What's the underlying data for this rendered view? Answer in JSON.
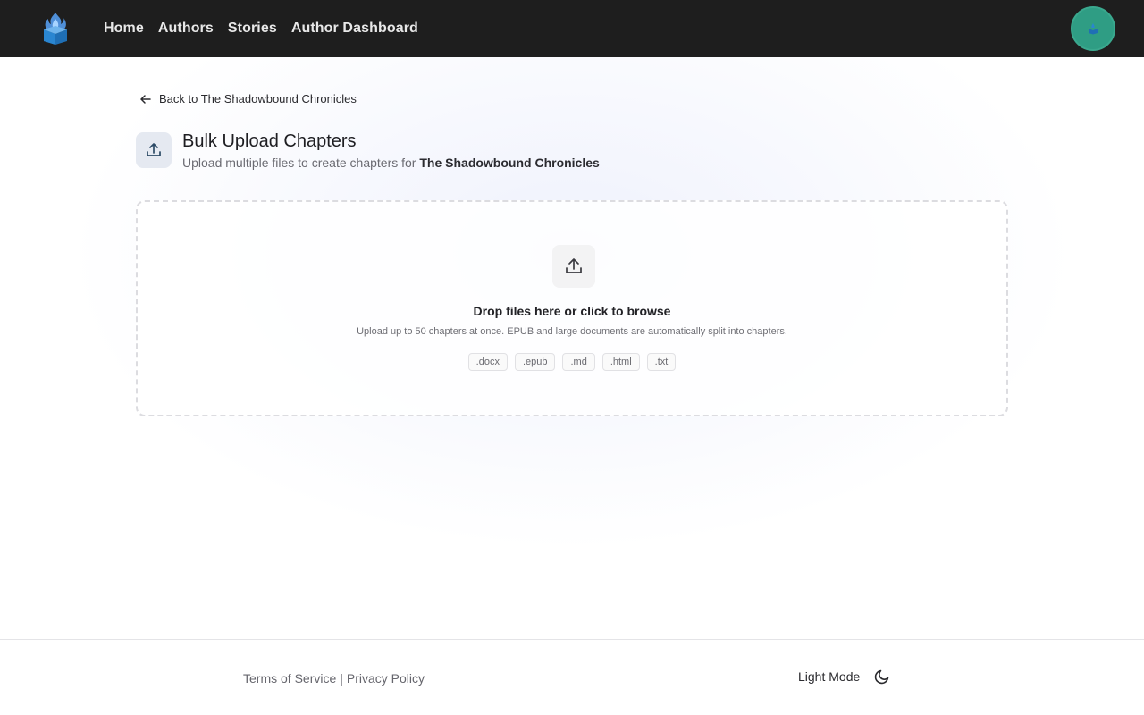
{
  "nav": {
    "links": [
      "Home",
      "Authors",
      "Stories",
      "Author Dashboard"
    ]
  },
  "back_link": "Back to The Shadowbound Chronicles",
  "header": {
    "title": "Bulk Upload Chapters",
    "subtitle_prefix": "Upload multiple files to create chapters for",
    "story_name": "The Shadowbound Chronicles"
  },
  "dropzone": {
    "title": "Drop files here or click to browse",
    "hint": "Upload up to 50 chapters at once. EPUB and large documents are automatically split into chapters.",
    "formats": [
      ".docx",
      ".epub",
      ".md",
      ".html",
      ".txt"
    ]
  },
  "footer": {
    "terms": "Terms of Service",
    "separator": "|",
    "privacy": "Privacy Policy",
    "theme_label": "Light Mode"
  },
  "icons": {
    "logo": "flame-book-logo",
    "back": "arrow-left-icon",
    "upload": "upload-icon",
    "theme": "moon-icon"
  },
  "colors": {
    "nav_bg": "#1e1e1e",
    "avatar": "#2f9d84"
  }
}
